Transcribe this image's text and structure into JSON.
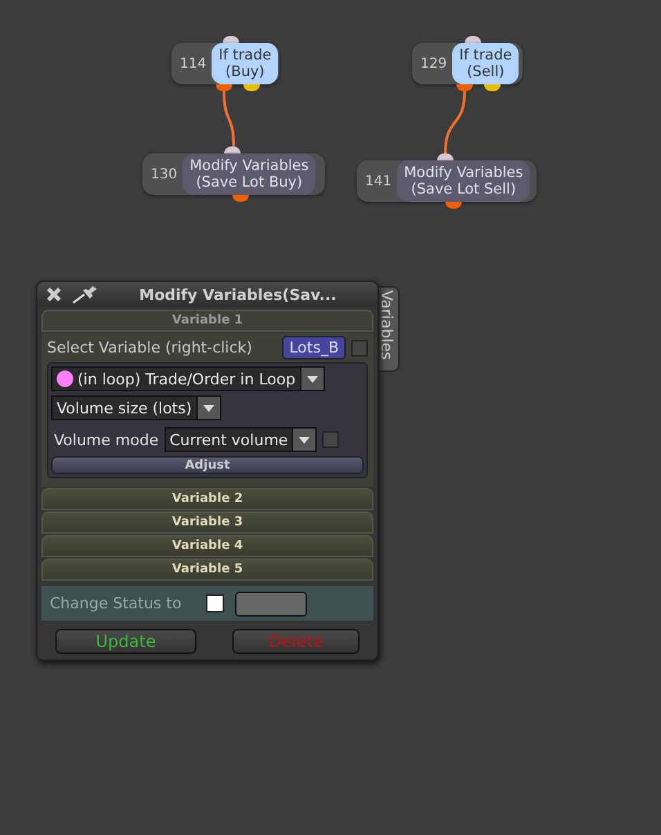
{
  "canvas": {
    "nodes": [
      {
        "id": "114",
        "kind": "condition",
        "title": "If trade",
        "subtitle": "(Buy)",
        "children": [
          {
            "id": "130",
            "kind": "action",
            "title": "Modify Variables",
            "subtitle": "(Save Lot Buy)"
          }
        ]
      },
      {
        "id": "129",
        "kind": "condition",
        "title": "If trade",
        "subtitle": "(Sell)",
        "children": [
          {
            "id": "141",
            "kind": "action",
            "title": "Modify Variables",
            "subtitle": "(Save Lot Sell)"
          }
        ]
      }
    ]
  },
  "panel": {
    "title": "Modify Variables(Sav...",
    "side_tab": "Variables",
    "sections": [
      {
        "label": "Variable 1",
        "expanded": true,
        "select_label": "Select Variable (right-click)",
        "variable": "Lots_B",
        "variable_checked": false,
        "source": {
          "label": "(in loop) Trade/Order in Loop",
          "color": "#ff80ff"
        },
        "property": "Volume size (lots)",
        "mode_label": "Volume mode",
        "mode": "Current volume",
        "mode_checked": false,
        "adjust": "Adjust"
      },
      {
        "label": "Variable 2",
        "expanded": false
      },
      {
        "label": "Variable 3",
        "expanded": false
      },
      {
        "label": "Variable 4",
        "expanded": false
      },
      {
        "label": "Variable 5",
        "expanded": false
      }
    ],
    "status": {
      "label": "Change Status to",
      "checked": false
    },
    "buttons": [
      {
        "label": "Update",
        "kind": "confirm"
      },
      {
        "label": "Delete",
        "kind": "danger"
      }
    ]
  }
}
